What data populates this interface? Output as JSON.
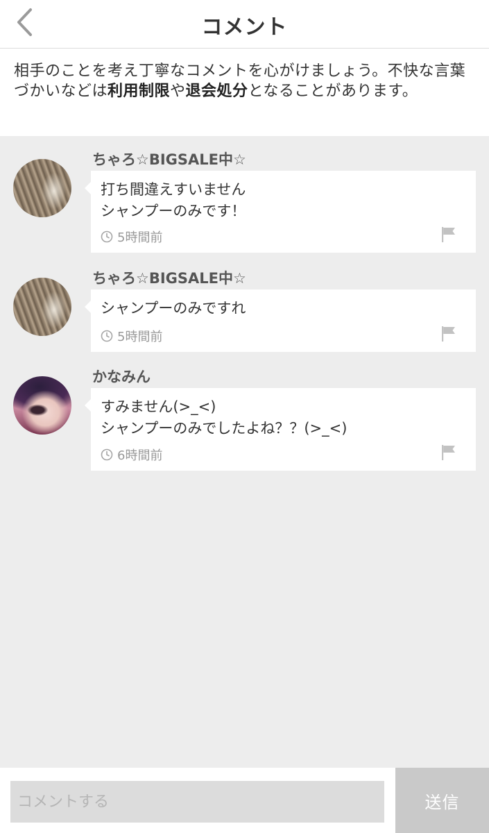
{
  "header": {
    "title": "コメント",
    "back_icon": "chevron-left-icon"
  },
  "notice": {
    "part1": "相手のことを考え丁寧なコメントを心がけましょう。不快な言葉づかいなどは",
    "bold1": "利用制限",
    "part2": "や",
    "bold2": "退会処分",
    "part3": "となることがあります。"
  },
  "comments": [
    {
      "username": "ちゃろ☆BIGSALE中☆",
      "text": "打ち間違えすいません\nシャンプーのみです！",
      "time": "5時間前"
    },
    {
      "username": "ちゃろ☆BIGSALE中☆",
      "text": "シャンプーのみですれ",
      "time": "5時間前"
    },
    {
      "username": "かなみん",
      "text": "すみません(>_<)\nシャンプーのみでしたよね？？(>_<)",
      "time": "6時間前"
    }
  ],
  "input": {
    "placeholder": "コメントする",
    "value": ""
  },
  "send_button": {
    "label": "送信"
  },
  "colors": {
    "background": "#ededed",
    "bubble": "#ffffff",
    "send_button": "#c9c9c9",
    "input_field": "#dcdcdc"
  }
}
